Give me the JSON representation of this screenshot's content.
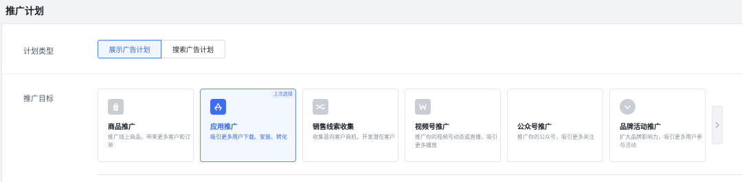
{
  "header": {
    "title": "推广计划"
  },
  "plan_type": {
    "label": "计划类型",
    "options": [
      "展示广告计划",
      "搜索广告计划"
    ],
    "selected": "展示广告计划"
  },
  "goal": {
    "label": "推广目标",
    "last_choice_badge": "上次选择",
    "cards": [
      {
        "title": "商品推广",
        "desc": "推广线上商品，带来更多客户和订单",
        "icon": "shopping-bag-icon"
      },
      {
        "title": "应用推广",
        "desc": "吸引更多用户下载、安装、转化",
        "icon": "app-store-icon",
        "selected": true
      },
      {
        "title": "销售线索收集",
        "desc": "收集意向客户商机，开发潜在客户",
        "icon": "leads-icon"
      },
      {
        "title": "视频号推广",
        "desc": "推广你的视频号动态或直播，吸引更多播放",
        "icon": "video-channel-icon"
      },
      {
        "title": "公众号推广",
        "desc": "推广你的公众号，吸引更多关注",
        "icon": ""
      },
      {
        "title": "品牌活动推广",
        "desc": "扩大品牌影响力，吸引更多用户参与活动",
        "icon": "brand-heart-icon"
      }
    ]
  },
  "colors": {
    "accent": "#2f67f6",
    "selected_bg": "#f3f7ff",
    "icon_gray": "#c9cdd4"
  }
}
